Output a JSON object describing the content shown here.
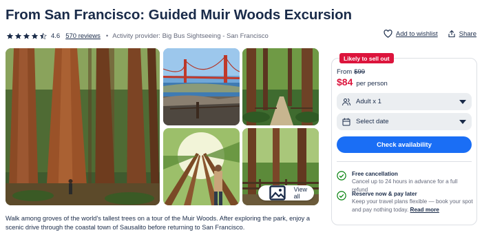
{
  "title": "From San Francisco: Guided Muir Woods Excursion",
  "rating": {
    "value": "4.6",
    "stars": 4.5,
    "reviews_label": "570 reviews"
  },
  "provider": "Activity provider: Big Bus Sightseeing - San Francisco",
  "separator": "•",
  "actions": {
    "wishlist": "Add to wishlist",
    "share": "Share"
  },
  "gallery": {
    "view_all": "View all"
  },
  "description": "Walk among groves of the world's tallest trees on a tour of the Muir Woods. After exploring the park, enjoy a scenic drive through the coastal town of Sausalito before returning to San Francisco.",
  "booking": {
    "badge": "Likely to sell out",
    "from_label": "From",
    "old_price": "$99",
    "price": "$84",
    "per": "per person",
    "participants": "Adult x 1",
    "date": "Select date",
    "cta": "Check availability",
    "features": [
      {
        "title": "Free cancellation",
        "desc": "Cancel up to 24 hours in advance for a full refund",
        "link": ""
      },
      {
        "title": "Reserve now & pay later",
        "desc": "Keep your travel plans flexible — book your spot and pay nothing today.",
        "link": "Read more"
      }
    ]
  },
  "colors": {
    "brand_navy": "#1a2b49",
    "accent_blue": "#1a6ef5",
    "sale_red": "#dc143c",
    "check_green": "#008009"
  }
}
